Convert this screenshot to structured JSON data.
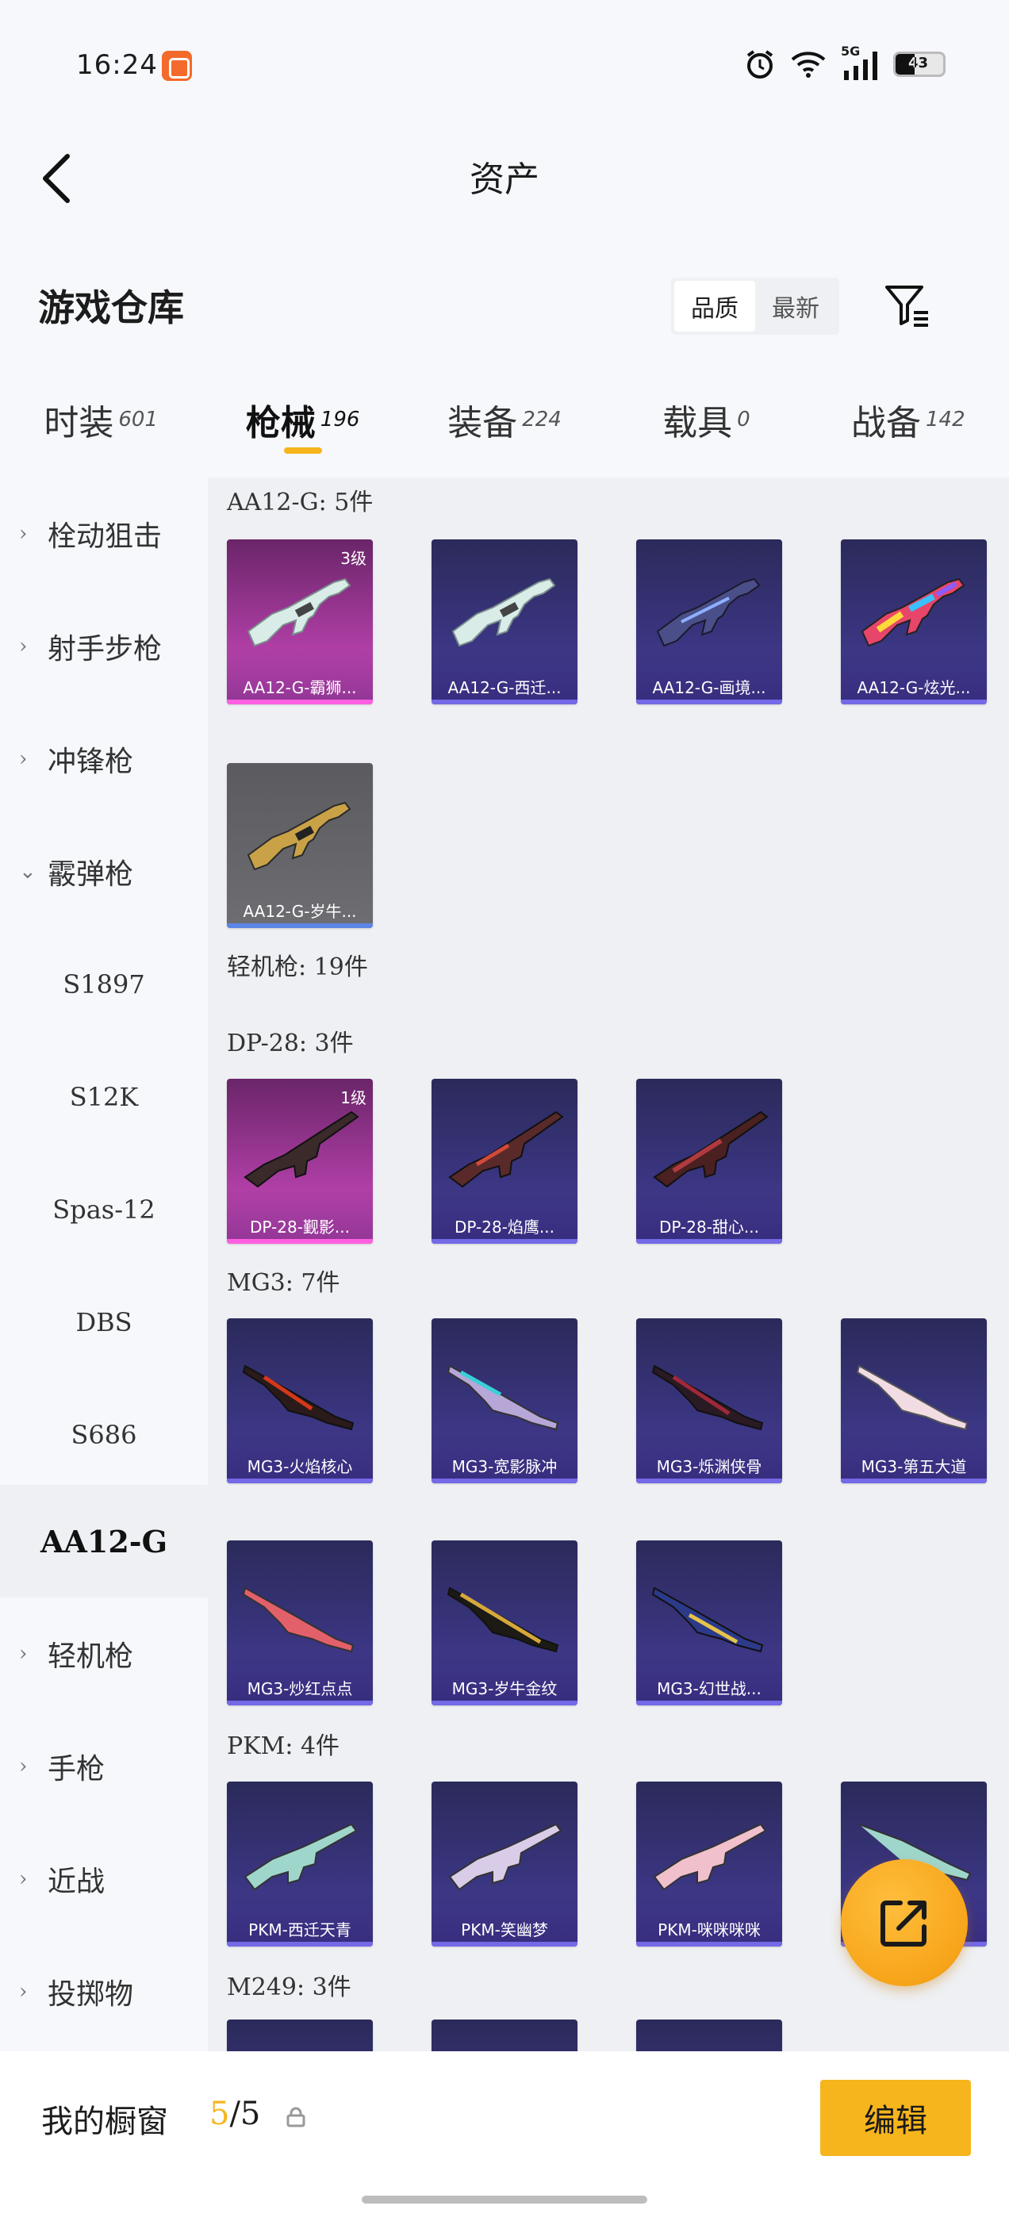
{
  "status": {
    "time": "16:24",
    "network": "5G",
    "battery": "43"
  },
  "header": {
    "title": "资产"
  },
  "warehouse": {
    "title": "游戏仓库",
    "sort_options": [
      "品质",
      "最新"
    ]
  },
  "category_tabs": [
    {
      "label": "时装",
      "count": "601"
    },
    {
      "label": "枪械",
      "count": "196"
    },
    {
      "label": "装备",
      "count": "224"
    },
    {
      "label": "载具",
      "count": "0"
    },
    {
      "label": "战备",
      "count": "142"
    }
  ],
  "sidebar": {
    "items": [
      {
        "label": "栓动狙击",
        "chevron": "›"
      },
      {
        "label": "射手步枪",
        "chevron": "›"
      },
      {
        "label": "冲锋枪",
        "chevron": "›"
      },
      {
        "label": "霰弹枪",
        "chevron": "⌄"
      },
      {
        "label": "S1897"
      },
      {
        "label": "S12K"
      },
      {
        "label": "Spas-12"
      },
      {
        "label": "DBS"
      },
      {
        "label": "S686"
      },
      {
        "label": "AA12-G"
      },
      {
        "label": "轻机枪",
        "chevron": "›"
      },
      {
        "label": "手枪",
        "chevron": "›"
      },
      {
        "label": "近战",
        "chevron": "›"
      },
      {
        "label": "投掷物",
        "chevron": "›"
      }
    ]
  },
  "groups": {
    "aa12": {
      "label": "AA12-G: 5件",
      "cards": [
        "AA12-G-霸狮...",
        "AA12-G-西迁...",
        "AA12-G-画境...",
        "AA12-G-炫光...",
        "AA12-G-岁牛..."
      ],
      "levels": [
        "3级"
      ]
    },
    "lmg": {
      "label": "轻机枪: 19件"
    },
    "dp28": {
      "label": "DP-28: 3件",
      "cards": [
        "DP-28-觐影...",
        "DP-28-焰鹰...",
        "DP-28-甜心..."
      ],
      "levels": [
        "1级"
      ]
    },
    "mg3": {
      "label": "MG3: 7件",
      "cards": [
        "MG3-火焰核心",
        "MG3-宽影脉冲",
        "MG3-烁渊侠骨",
        "MG3-第五大道",
        "MG3-炒红点点",
        "MG3-岁牛金纹",
        "MG3-幻世战..."
      ]
    },
    "pkm": {
      "label": "PKM: 4件",
      "cards": [
        "PKM-西迁天青",
        "PKM-笑幽梦",
        "PKM-咪咪咪咪"
      ]
    },
    "m249": {
      "label": "M249: 3件"
    }
  },
  "bottom": {
    "showcase_label": "我的橱窗",
    "showcase_current": "5",
    "showcase_total": "/5",
    "edit_label": "编辑"
  },
  "colors": {
    "accent": "#f6b51d",
    "card_purple": "#3a3580",
    "card_pink": "#a43a9c"
  }
}
